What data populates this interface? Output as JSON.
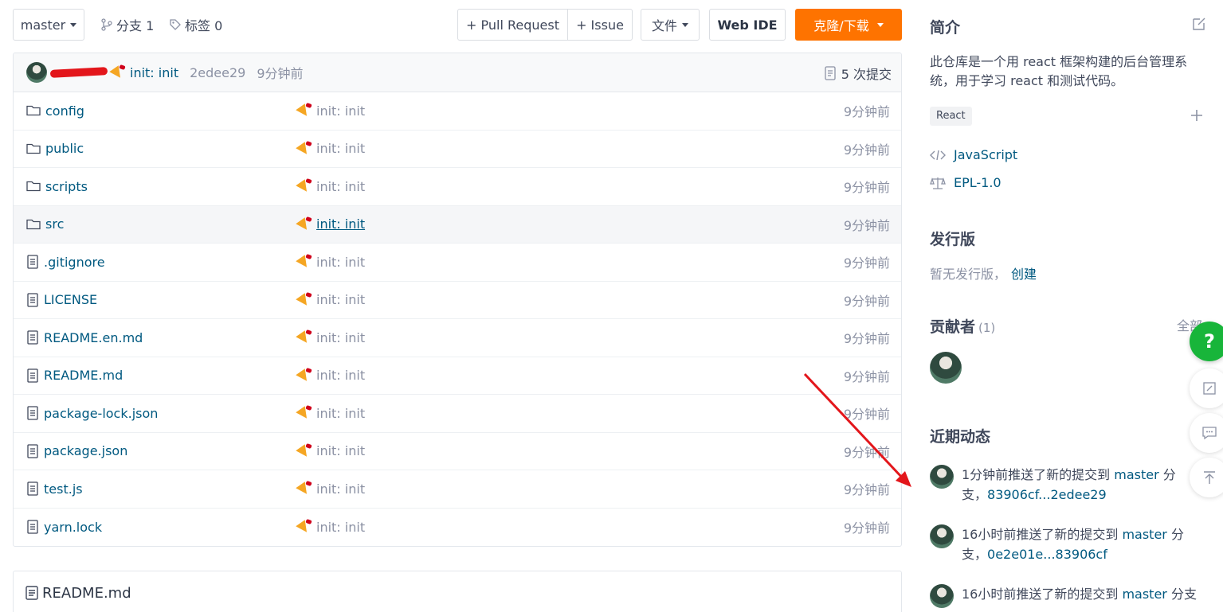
{
  "toolbar": {
    "branch": "master",
    "branches_label": "分支 1",
    "tags_label": "标签 0",
    "pull_request": "+ Pull Request",
    "issue": "+ Issue",
    "files": "文件",
    "web_ide": "Web IDE",
    "clone": "克隆/下载"
  },
  "commit_bar": {
    "message": "init: init",
    "hash": "2edee29",
    "time": "9分钟前",
    "commit_count": "5 次提交"
  },
  "files": [
    {
      "name": "config",
      "type": "folder",
      "commit": "init: init",
      "time": "9分钟前"
    },
    {
      "name": "public",
      "type": "folder",
      "commit": "init: init",
      "time": "9分钟前"
    },
    {
      "name": "scripts",
      "type": "folder",
      "commit": "init: init",
      "time": "9分钟前"
    },
    {
      "name": "src",
      "type": "folder",
      "commit": "init: init",
      "time": "9分钟前"
    },
    {
      "name": ".gitignore",
      "type": "file",
      "commit": "init: init",
      "time": "9分钟前"
    },
    {
      "name": "LICENSE",
      "type": "file",
      "commit": "init: init",
      "time": "9分钟前"
    },
    {
      "name": "README.en.md",
      "type": "file",
      "commit": "init: init",
      "time": "9分钟前"
    },
    {
      "name": "README.md",
      "type": "file",
      "commit": "init: init",
      "time": "9分钟前"
    },
    {
      "name": "package-lock.json",
      "type": "file",
      "commit": "init: init",
      "time": "9分钟前"
    },
    {
      "name": "package.json",
      "type": "file",
      "commit": "init: init",
      "time": "9分钟前"
    },
    {
      "name": "test.js",
      "type": "file",
      "commit": "init: init",
      "time": "9分钟前"
    },
    {
      "name": "yarn.lock",
      "type": "file",
      "commit": "init: init",
      "time": "9分钟前"
    }
  ],
  "readme": {
    "title": "README.md"
  },
  "side": {
    "intro_title": "简介",
    "intro_text": "此仓库是一个用 react 框架构建的后台管理系统，用于学习 react 和测试代码。",
    "tag": "React",
    "language": "JavaScript",
    "license": "EPL-1.0",
    "release_title": "发行版",
    "release_text": "暂无发行版，",
    "release_create": "创建",
    "contributors_title": "贡献者",
    "contributors_count": "(1)",
    "contributors_all": "全部",
    "activity_title": "近期动态",
    "activities": [
      {
        "prefix": "1分钟前推送了新的提交到 ",
        "branch": "master",
        "mid": " 分支，",
        "range": "83906cf...2edee29"
      },
      {
        "prefix": "16小时前推送了新的提交到 ",
        "branch": "master",
        "mid": " 分支，",
        "range": "0e2e01e...83906cf"
      },
      {
        "prefix": "16小时前推送了新的提交到 ",
        "branch": "master",
        "mid": " 分支",
        "range": ""
      }
    ]
  },
  "floating": {
    "help": "?"
  },
  "colors": {
    "accent": "#fe7300",
    "link": "#005980",
    "help": "#18b53a",
    "annotation": "#e3161b"
  }
}
